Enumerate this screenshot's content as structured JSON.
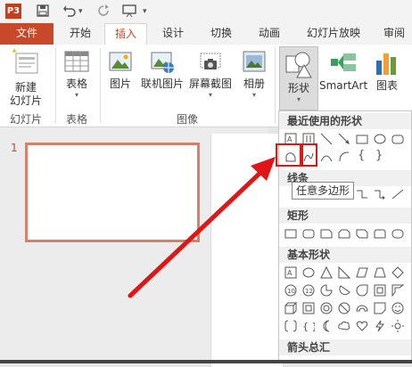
{
  "app": {
    "logo_text": "P3"
  },
  "quick_access": {
    "save_icon": "save-icon",
    "undo_icon": "undo-icon",
    "redo_icon": "redo-icon",
    "present_icon": "present-icon"
  },
  "tabs": [
    {
      "label": "文件"
    },
    {
      "label": "开始"
    },
    {
      "label": "插入"
    },
    {
      "label": "设计"
    },
    {
      "label": "切换"
    },
    {
      "label": "动画"
    },
    {
      "label": "幻灯片放映"
    },
    {
      "label": "审阅"
    }
  ],
  "ribbon": {
    "new_slide": {
      "label1": "新建",
      "label2": "幻灯片"
    },
    "table": {
      "label": "表格"
    },
    "picture": {
      "label": "图片"
    },
    "online_picture": {
      "label": "联机图片"
    },
    "screenshot": {
      "label": "屏幕截图"
    },
    "album": {
      "label": "相册"
    },
    "shapes": {
      "label": "形状"
    },
    "smartart": {
      "label": "SmartArt"
    },
    "chart": {
      "label": "图表"
    },
    "groups": {
      "slides": "幻灯片",
      "tables": "表格",
      "images": "图像"
    }
  },
  "slides": [
    {
      "number": "1"
    }
  ],
  "shapes_menu": {
    "recent": "最近使用的形状",
    "lines": "线条",
    "rectangles": "矩形",
    "basic": "基本形状",
    "arrows": "箭头总汇"
  },
  "tooltip": {
    "text": "任意多边形"
  },
  "colors": {
    "accent": "#c8492a",
    "highlight": "#e01515"
  }
}
